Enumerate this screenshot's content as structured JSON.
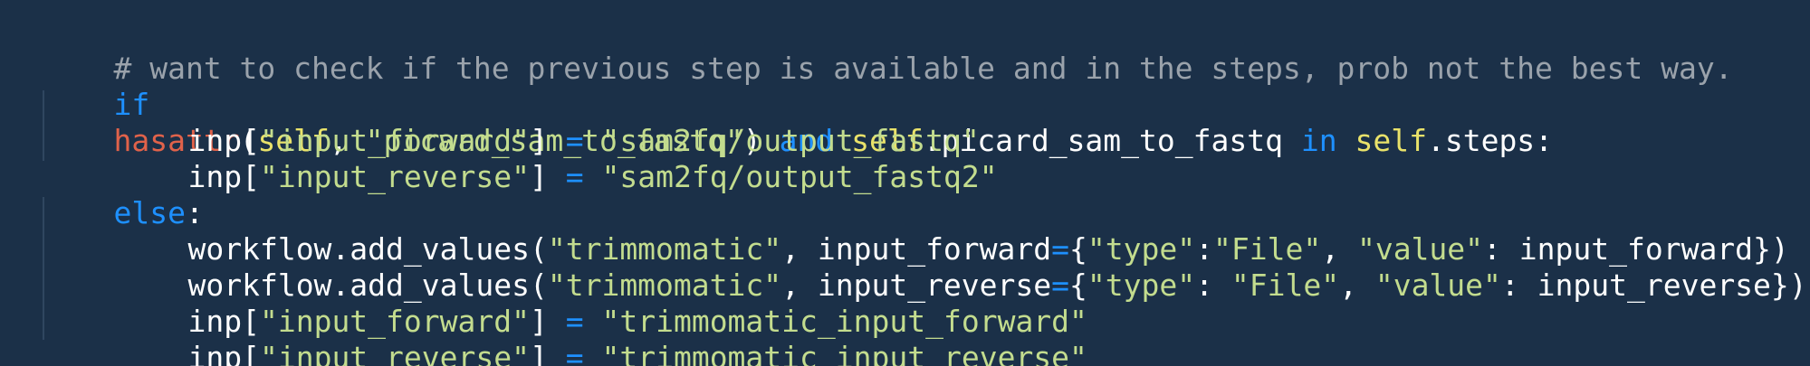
{
  "colors": {
    "background": "#1b3048",
    "comment": "#9aa2ab",
    "keyword": "#1e90ff",
    "builtin": "#e0624a",
    "self": "#e9e26a",
    "string": "#c3dc8e",
    "plain": "#ffffff"
  },
  "code": {
    "line1": {
      "comment": "# want to check if the previous step is available and in the steps, prob not the best way."
    },
    "line2": {
      "kw_if": "if",
      "builtin": "hasattr",
      "p1": "(",
      "self1": "self",
      "p2": ", ",
      "str1": "\"picard_sam_to_fastq\"",
      "p3": ") ",
      "kw_and": "and",
      "p4": " ",
      "self2": "self",
      "p5": ".picard_sam_to_fastq ",
      "kw_in": "in",
      "p6": " ",
      "self3": "self",
      "p7": ".steps:"
    },
    "line3": {
      "a": "inp[",
      "key": "\"input_forward\"",
      "b": "] ",
      "eq": "=",
      "c": " ",
      "val": "\"sam2fq/output_fastq\""
    },
    "line4": {
      "a": "inp[",
      "key": "\"input_reverse\"",
      "b": "] ",
      "eq": "=",
      "c": " ",
      "val": "\"sam2fq/output_fastq2\""
    },
    "line5": {
      "kw_else": "else",
      "colon": ":"
    },
    "line6": {
      "a": "workflow.add_values(",
      "s1": "\"trimmomatic\"",
      "b": ", input_forward",
      "eq": "=",
      "c": "{",
      "s2": "\"type\"",
      "d": ":",
      "s3": "\"File\"",
      "e": ", ",
      "s4": "\"value\"",
      "f": ": input_forward})"
    },
    "line7": {
      "a": "workflow.add_values(",
      "s1": "\"trimmomatic\"",
      "b": ", input_reverse",
      "eq": "=",
      "c": "{",
      "s2": "\"type\"",
      "d": ": ",
      "s3": "\"File\"",
      "e": ", ",
      "s4": "\"value\"",
      "f": ": input_reverse})"
    },
    "line8": {
      "a": "inp[",
      "key": "\"input_forward\"",
      "b": "] ",
      "eq": "=",
      "c": " ",
      "val": "\"trimmomatic_input_forward\""
    },
    "line9": {
      "a": "inp[",
      "key": "\"input_reverse\"",
      "b": "] ",
      "eq": "=",
      "c": " ",
      "val": "\"trimmomatic_input_reverse\""
    }
  }
}
